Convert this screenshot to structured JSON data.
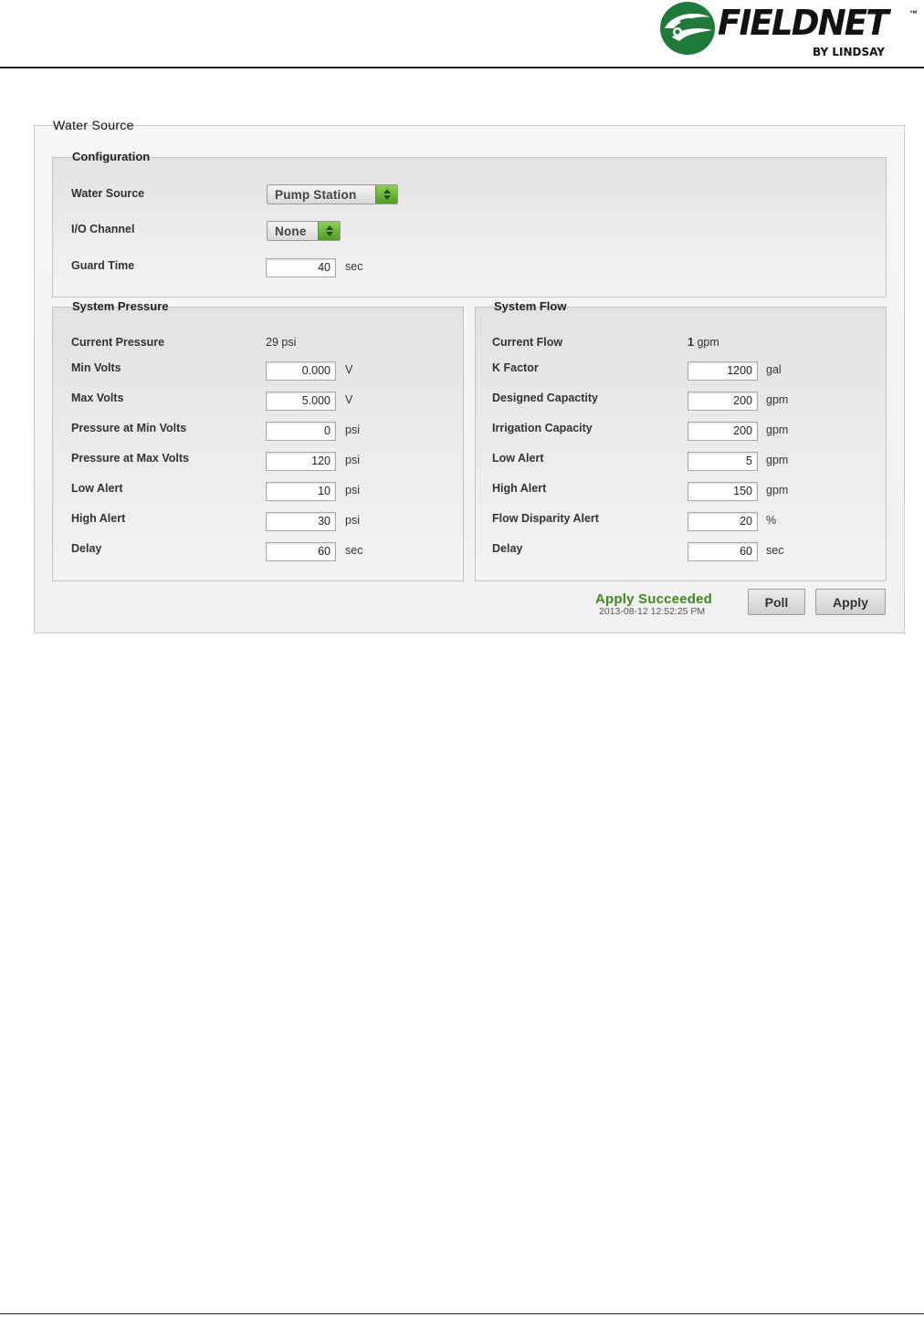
{
  "brand": {
    "name": "FIELDNET",
    "tm": "™",
    "by": "BY LINDSAY",
    "colors": {
      "emblem_green": "#1f7a3a",
      "text": "#111111"
    }
  },
  "water_source_panel": {
    "title": "Water Source",
    "configuration": {
      "title": "Configuration",
      "water_source_label": "Water Source",
      "water_source_value": "Pump Station",
      "io_channel_label": "I/O Channel",
      "io_channel_value": "None",
      "guard_time_label": "Guard Time",
      "guard_time_value": "40",
      "guard_time_unit": "sec"
    },
    "system_pressure": {
      "title": "System Pressure",
      "current_label": "Current Pressure",
      "current_value": "29 psi",
      "rows": [
        {
          "label": "Min Volts",
          "value": "0.000",
          "unit": "V"
        },
        {
          "label": "Max Volts",
          "value": "5.000",
          "unit": "V"
        },
        {
          "label": "Pressure at Min Volts",
          "value": "0",
          "unit": "psi"
        },
        {
          "label": "Pressure at Max Volts",
          "value": "120",
          "unit": "psi"
        },
        {
          "label": "Low Alert",
          "value": "10",
          "unit": "psi"
        },
        {
          "label": "High Alert",
          "value": "30",
          "unit": "psi"
        },
        {
          "label": "Delay",
          "value": "60",
          "unit": "sec"
        }
      ]
    },
    "system_flow": {
      "title": "System Flow",
      "current_label": "Current Flow",
      "current_value_num": "1",
      "current_value_unit": "gpm",
      "rows": [
        {
          "label": "K Factor",
          "value": "1200",
          "unit": "gal"
        },
        {
          "label": "Designed Capactity",
          "value": "200",
          "unit": "gpm"
        },
        {
          "label": "Irrigation Capacity",
          "value": "200",
          "unit": "gpm"
        },
        {
          "label": "Low Alert",
          "value": "5",
          "unit": "gpm"
        },
        {
          "label": "High Alert",
          "value": "150",
          "unit": "gpm"
        },
        {
          "label": "Flow Disparity Alert",
          "value": "20",
          "unit": "%"
        },
        {
          "label": "Delay",
          "value": "60",
          "unit": "sec"
        }
      ]
    },
    "status": {
      "text": "Apply Succeeded",
      "timestamp": "2013-08-12 12:52:25 PM",
      "color": "#3e8a1e"
    },
    "buttons": {
      "poll": "Poll",
      "apply": "Apply"
    }
  }
}
